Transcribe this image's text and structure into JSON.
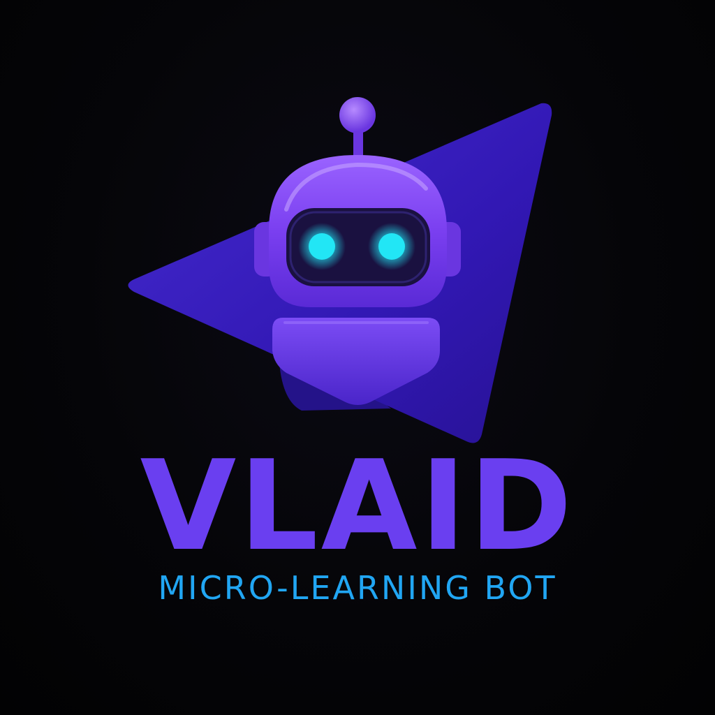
{
  "brand": {
    "name": "VLAID",
    "tagline": "MICRO-LEARNING BOT"
  },
  "icons": {
    "logo": "robot-head-icon",
    "backdrop": "paper-plane-triangle-icon"
  },
  "colors": {
    "background": "#050508",
    "name": "#6a3ff0",
    "tagline": "#21a6f3",
    "triangle": "#3a1fc9",
    "robot_body": "#7a3ff0",
    "robot_visor": "#1a1140",
    "robot_eyes": "#22e6f5"
  }
}
